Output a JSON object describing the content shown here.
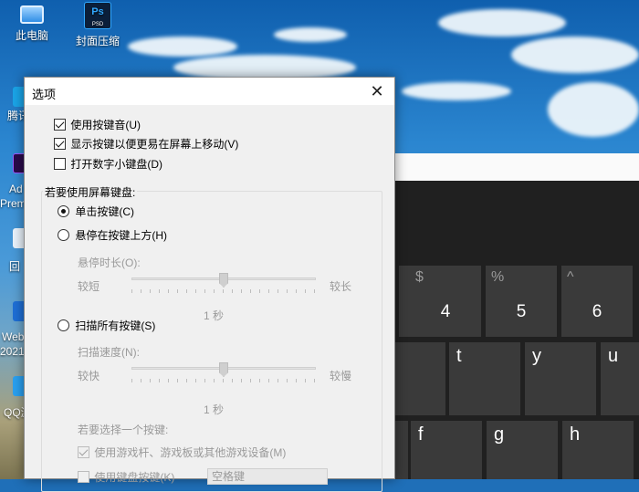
{
  "desktop": {
    "icons": [
      {
        "label": "此电脑",
        "icon": "computer-icon"
      },
      {
        "label": "封面压缩",
        "icon": "photoshop-file-icon",
        "badge": "Ps",
        "sub": "PSD"
      }
    ],
    "partial_labels": [
      "腾讯",
      "Ad",
      "Prem",
      "回",
      "Web",
      "2021",
      "QQ游"
    ]
  },
  "keyboard": {
    "row1": [
      {
        "symbol": "$",
        "key": "4"
      },
      {
        "symbol": "%",
        "key": "5"
      },
      {
        "symbol": "^",
        "key": "6"
      }
    ],
    "row2": [
      "t",
      "y",
      "u"
    ],
    "row3": [
      "f",
      "g",
      "h"
    ]
  },
  "dialog": {
    "title": "选项",
    "close": "✕",
    "options": {
      "click_sound": "使用按键音(U)",
      "show_keys": "显示按键以便更易在屏幕上移动(V)",
      "numpad": "打开数字小键盘(D)"
    },
    "group_title": "若要使用屏幕键盘:",
    "modes": {
      "click": "单击按键(C)",
      "hover": "悬停在按键上方(H)",
      "scan": "扫描所有按键(S)"
    },
    "hover_duration": {
      "label": "悬停时长(O):",
      "short": "较短",
      "long": "较长",
      "value": "1 秒",
      "level": 0.5
    },
    "scan_speed": {
      "label": "扫描速度(N):",
      "fast": "较快",
      "slow": "较慢",
      "value": "1 秒",
      "level": 0.5
    },
    "choose_key": {
      "label": "若要选择一个按键:",
      "joystick": "使用游戏杆、游戏板或其他游戏设备(M)",
      "keyboard_key": "使用键盘按键(K)",
      "keyboard_key_value": "空格键"
    }
  }
}
